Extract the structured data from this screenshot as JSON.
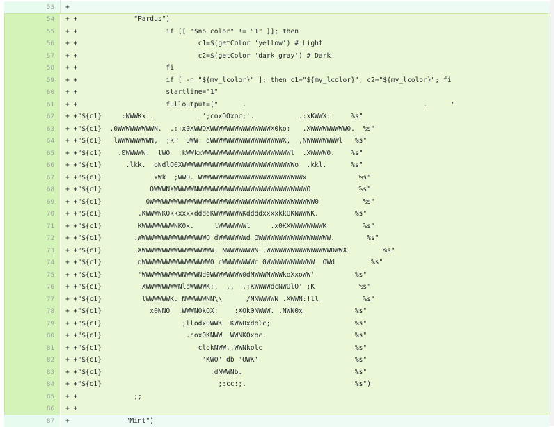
{
  "diff": {
    "lines": [
      {
        "n": "53",
        "t": "+"
      },
      {
        "n": "54",
        "t": "+ +              \"Pardus\")"
      },
      {
        "n": "55",
        "t": "+ +                      if [[ \"$no_color\" != \"1\" ]]; then"
      },
      {
        "n": "56",
        "t": "+ +                              c1=$(getColor 'yellow') # Light"
      },
      {
        "n": "57",
        "t": "+ +                              c2=$(getColor 'dark gray') # Dark"
      },
      {
        "n": "58",
        "t": "+ +                      fi"
      },
      {
        "n": "59",
        "t": "+ +                      if [ -n \"${my_lcolor}\" ]; then c1=\"${my_lcolor}\"; c2=\"${my_lcolor}\"; fi"
      },
      {
        "n": "60",
        "t": "+ +                      startline=\"1\""
      },
      {
        "n": "61",
        "t": "+ +                      fulloutput=(\"      .                                            .      \""
      },
      {
        "n": "62",
        "t": "+ +\"${c1}     :NWWKx:.           .';coxOOxoc;'.           .:xKWWX:     %s\""
      },
      {
        "n": "63",
        "t": "+ +\"${c1}  .0WWWWWWWWWN.  .::x0XWWOXWWWWWWWWWWWWWWWX0ko:   .XWWWWWWWWW0.  %s\""
      },
      {
        "n": "64",
        "t": "+ +\"${c1}   lWWWWWWWWN,  ;kP  OWW: dWWWWWWWWWWWWWWWWWWX,  ,NWWWWWWWWl   %s\""
      },
      {
        "n": "65",
        "t": "+ +\"${c1}    .0WWWWN.  lWO  .kWWkxWWWWWWWWWWWWWWWWWWWWWWl  .XWWWW0.    %s\""
      },
      {
        "n": "66",
        "t": "+ +\"${c1}      .lkk.  oNdlO0XWWWWWWWWWWWWWWWWWWWWWWWWWWWWo  .kkl.      %s\""
      },
      {
        "n": "67",
        "t": "+ +\"${c1}             xWk  ;WWO. WWWWWWWWWWWWWWWWWWWWWWWWWWx             %s\""
      },
      {
        "n": "68",
        "t": "+ +\"${c1}            OWWWNXWWWWWNWWWWWWWWWWWWWWWWWWWWWWWWWWWO            %s\""
      },
      {
        "n": "69",
        "t": "+ +\"${c1}           0WWWWWWWWWWWWWWWWWWWWWWWWWWWWWWWWWWWWWWWWW0           %s\""
      },
      {
        "n": "70",
        "t": "+ +\"${c1}         .KWWWNKOkkxxxxddddKWWWWWWWKddddxxxxkkOKNWWWK.         %s\""
      },
      {
        "n": "71",
        "t": "+ +\"${c1}         KWWWWWWWWNK0x.     lWWWWWWWl     .x0KXWWWWWWWWK         %s\""
      },
      {
        "n": "72",
        "t": "+ +\"${c1}        .WWWWWWWWWWWWWWWWWO dWWWWWWWd OWWWWWWWWWWWWWWWWWW.        %s\""
      },
      {
        "n": "73",
        "t": "+ +\"${c1}         XWWWWWWWWWWWWWWWWWW, NWWWWWWWN ,WWWWWWWWWWWWWWWWOWWX         %s\""
      },
      {
        "n": "74",
        "t": "+ +\"${c1}         dWWWWWWWWWWWWWWWWW0 cWWWWWWWWc 0WWWWWWWWWWWW  OWd         %s\""
      },
      {
        "n": "75",
        "t": "+ +\"${c1}         'WWWWWWWWWWNWWWNd0WWWWWWWW0dNWWWNWWWkoXxoWW'          %s\""
      },
      {
        "n": "76",
        "t": "+ +\"${c1}          XWWWWWWWWNldWWWWK;,  ,,  ,;KWWWWdcNWOlO' ;K           %s\""
      },
      {
        "n": "77",
        "t": "+ +\"${c1}          lWWWWWWK. NWWWWWNN\\\\      /NNWWWWN .XWWN:!ll           %s\""
      },
      {
        "n": "78",
        "t": "+ +\"${c1}            x0NNO  .WWWN0kOX:    :XOk0NWWW. .NWN0x             %s\""
      },
      {
        "n": "79",
        "t": "+ +\"${c1}                    ;llodx0WWK  KWW0xdolc;                     %s\""
      },
      {
        "n": "80",
        "t": "+ +\"${c1}                     .cox0KNWW  WWNK0xoc.                      %s\""
      },
      {
        "n": "81",
        "t": "+ +\"${c1}                        clokNWW..WWNkolc                       %s\""
      },
      {
        "n": "82",
        "t": "+ +\"${c1}                         'KWO' db 'OWK'                        %s\""
      },
      {
        "n": "83",
        "t": "+ +\"${c1}                           .dNWWNb.                            %s\""
      },
      {
        "n": "84",
        "t": "+ +\"${c1}                             ;:cc:;.                           %s\")"
      },
      {
        "n": "85",
        "t": "+ +              ;;"
      },
      {
        "n": "86",
        "t": "+ +"
      },
      {
        "n": "87",
        "t": "+              \"Mint\")"
      }
    ]
  }
}
